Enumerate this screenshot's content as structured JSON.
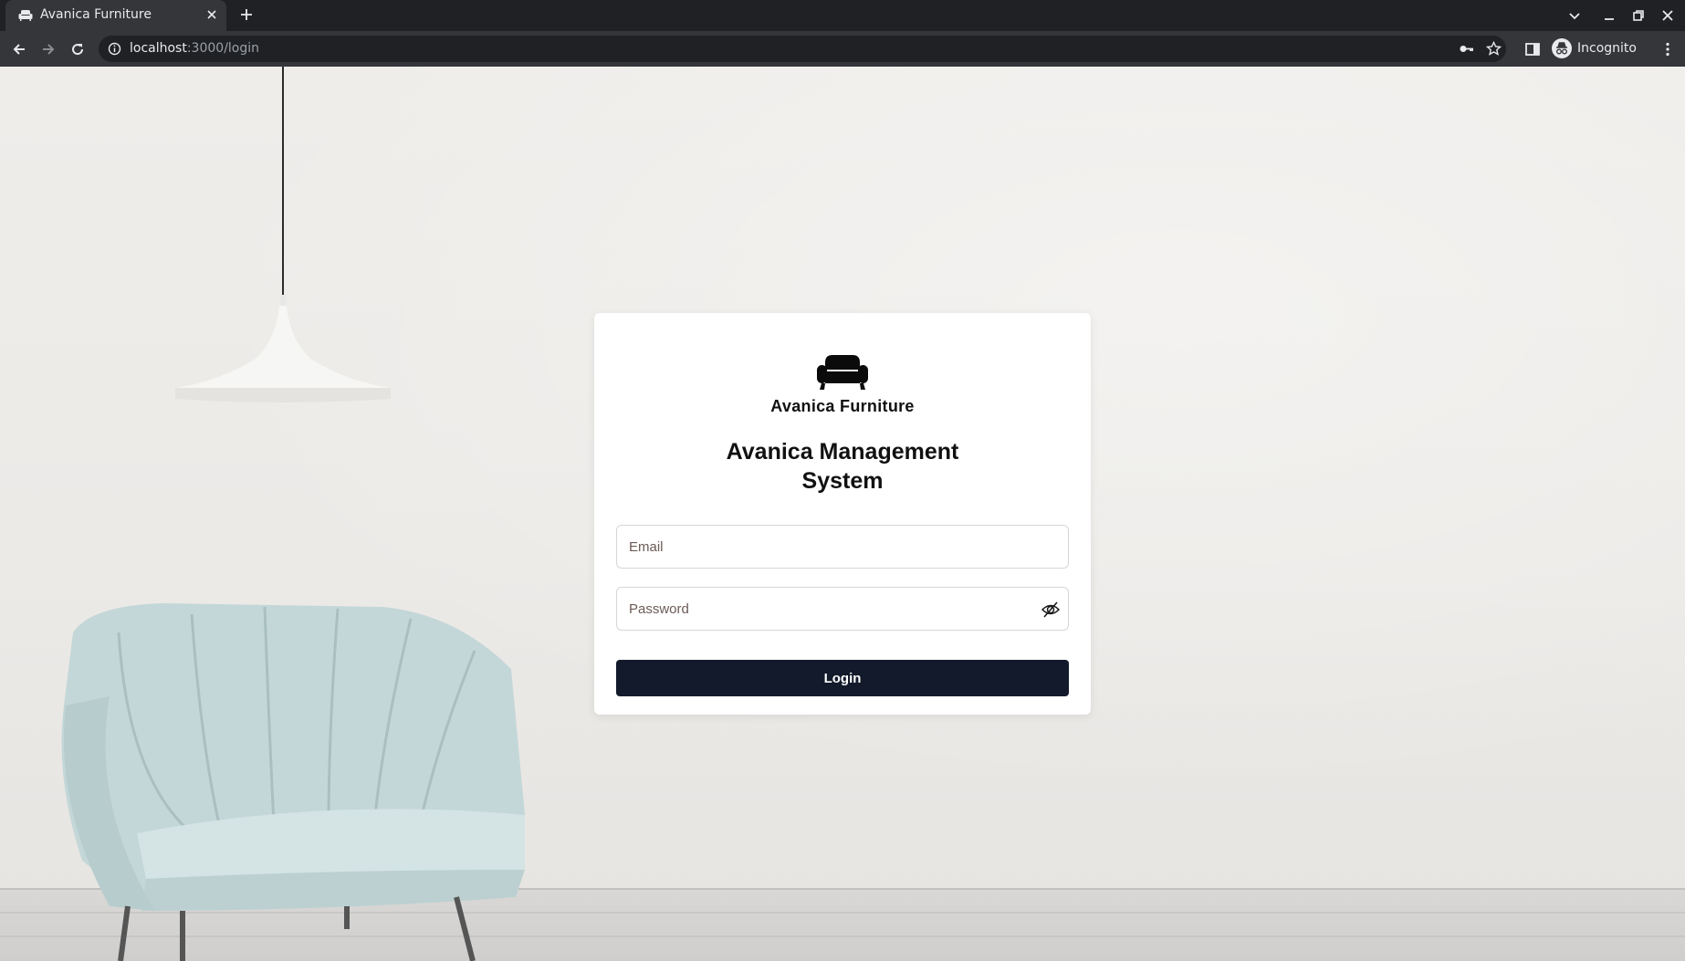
{
  "browser": {
    "tab_title": "Avanica Furniture",
    "url_host": "localhost",
    "url_path": ":3000/login",
    "profile_label": "Incognito"
  },
  "login": {
    "brand_name": "Avanica Furniture",
    "heading": "Avanica Management System",
    "email_placeholder": "Email",
    "password_placeholder": "Password",
    "login_label": "Login"
  },
  "colors": {
    "button_bg": "#121a2b",
    "card_bg": "#ffffff"
  }
}
